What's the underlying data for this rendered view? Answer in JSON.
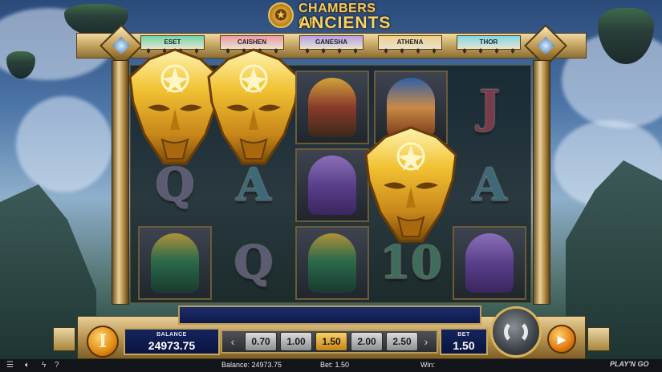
{
  "game": {
    "title_line1": "CHAMBERS OF",
    "title_line2": "ANCIENTS"
  },
  "gods": [
    {
      "name": "ESET",
      "color": "#6fd8a8"
    },
    {
      "name": "CAISHEN",
      "color": "#ef9aa6"
    },
    {
      "name": "GANESHA",
      "color": "#b7a0e6"
    },
    {
      "name": "ATHENA",
      "color": "#f1cf8a"
    },
    {
      "name": "THOR",
      "color": "#7fd8e8"
    }
  ],
  "reels": [
    [
      "mask",
      "Q",
      "eset"
    ],
    [
      "mask",
      "A",
      "Q"
    ],
    [
      "athena",
      "ganesha",
      "eset"
    ],
    [
      "thor",
      "mask",
      "10"
    ],
    [
      "J",
      "A",
      "ganesha"
    ]
  ],
  "controls": {
    "info_label": "I",
    "balance_label": "BALANCE",
    "balance_value": "24973.75",
    "bet_options": [
      "0.70",
      "1.00",
      "1.50",
      "2.00",
      "2.50"
    ],
    "selected_bet": "1.50",
    "bet_label": "BET",
    "bet_value": "1.50",
    "autoplay_icon": "play-icon",
    "spin_icon": "spin-icon"
  },
  "footer": {
    "balance_text": "Balance: 24973.75",
    "bet_text": "Bet: 1.50",
    "win_text": "Win:",
    "brand": "PLAY'N GO",
    "icons": [
      "menu-icon",
      "sound-icon",
      "turbo-icon",
      "help-icon"
    ]
  }
}
